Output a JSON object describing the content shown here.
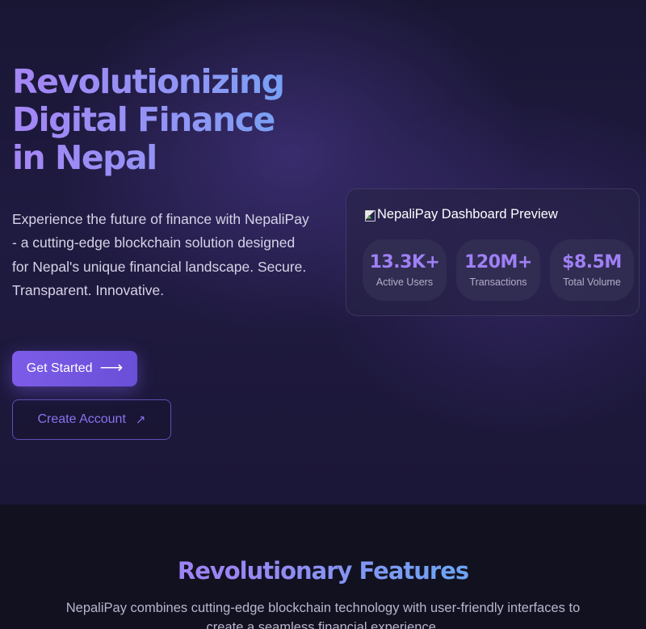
{
  "hero": {
    "title_lines": [
      "Revolutionizing",
      "Digital Finance",
      "in Nepal"
    ],
    "description": "Experience the future of finance with NepaliPay - a cutting-edge blockchain solution designed for Nepal's unique financial landscape. Secure. Transparent. Innovative.",
    "primary_button": {
      "label": "Get Started",
      "icon": "arrow-right-icon"
    },
    "secondary_button": {
      "label": "Create Account",
      "icon": "arrow-up-right-icon"
    }
  },
  "preview": {
    "image_alt": "NepaliPay Dashboard Preview",
    "icon": "broken-image-icon",
    "stats": [
      {
        "value": "13.3K+",
        "label": "Active Users"
      },
      {
        "value": "120M+",
        "label": "Transactions"
      },
      {
        "value": "$8.5M",
        "label": "Total Volume"
      }
    ]
  },
  "features": {
    "title": "Revolutionary Features",
    "description": "NepaliPay combines cutting-edge blockchain technology with user-friendly interfaces to create a seamless financial experience."
  },
  "colors": {
    "accent": "#7c5ce8",
    "accent_text": "#9f80f5",
    "gradient_end": "#6ea4f3",
    "background": "#12101f"
  }
}
